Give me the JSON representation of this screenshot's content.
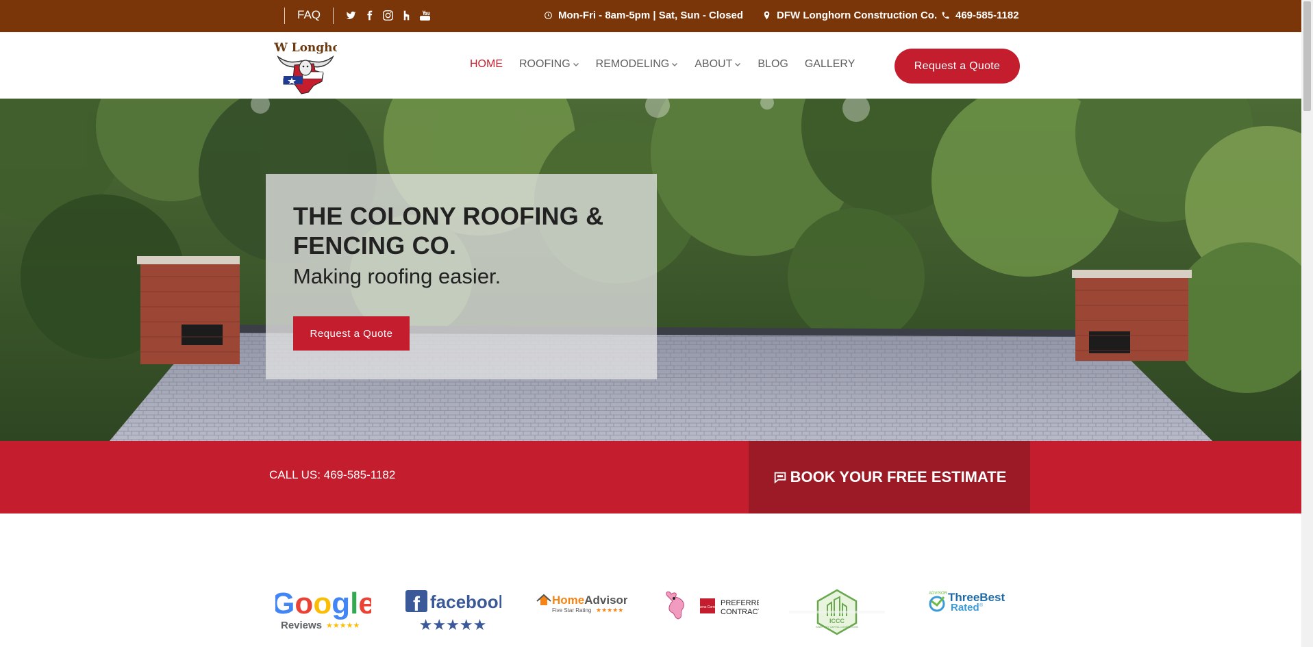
{
  "topbar": {
    "faq": "FAQ",
    "social": [
      "twitter-icon",
      "facebook-icon",
      "instagram-icon",
      "houzz-icon",
      "youtube-icon"
    ],
    "hours": "Mon-Fri - 8am-5pm | Sat, Sun - Closed",
    "company": "DFW Longhorn Construction Co.",
    "phone": "469-585-1182"
  },
  "header": {
    "logo_text": "DFW Longhorn",
    "nav": [
      {
        "label": "HOME",
        "active": true
      },
      {
        "label": "ROOFING",
        "dropdown": true
      },
      {
        "label": "REMODELING",
        "dropdown": true
      },
      {
        "label": "ABOUT",
        "dropdown": true
      },
      {
        "label": "BLOG"
      },
      {
        "label": "GALLERY"
      }
    ],
    "quote_button": "Request a Quote"
  },
  "hero": {
    "title": "THE COLONY ROOFING & FENCING CO.",
    "subtitle": "Making roofing easier.",
    "button": "Request a Quote"
  },
  "band": {
    "call": "CALL US: 469-585-1182",
    "estimate": "BOOK YOUR FREE ESTIMATE"
  },
  "badges": {
    "google": {
      "word": "Google",
      "sub": "Reviews"
    },
    "facebook": {
      "word": "facebook"
    },
    "homeadvisor": {
      "word": "HomeAdvisor",
      "sub": "Five Star Rating"
    },
    "owens": {
      "line1": "PREFERRED",
      "line2": "CONTRACTOR"
    },
    "iccc": {
      "word": "ICCC"
    },
    "threebest": {
      "line1": "ThreeBest",
      "line2": "Rated"
    }
  },
  "colors": {
    "topbar": "#7a3508",
    "accent_red": "#c41e2e",
    "dark_red": "#9b1a25"
  }
}
